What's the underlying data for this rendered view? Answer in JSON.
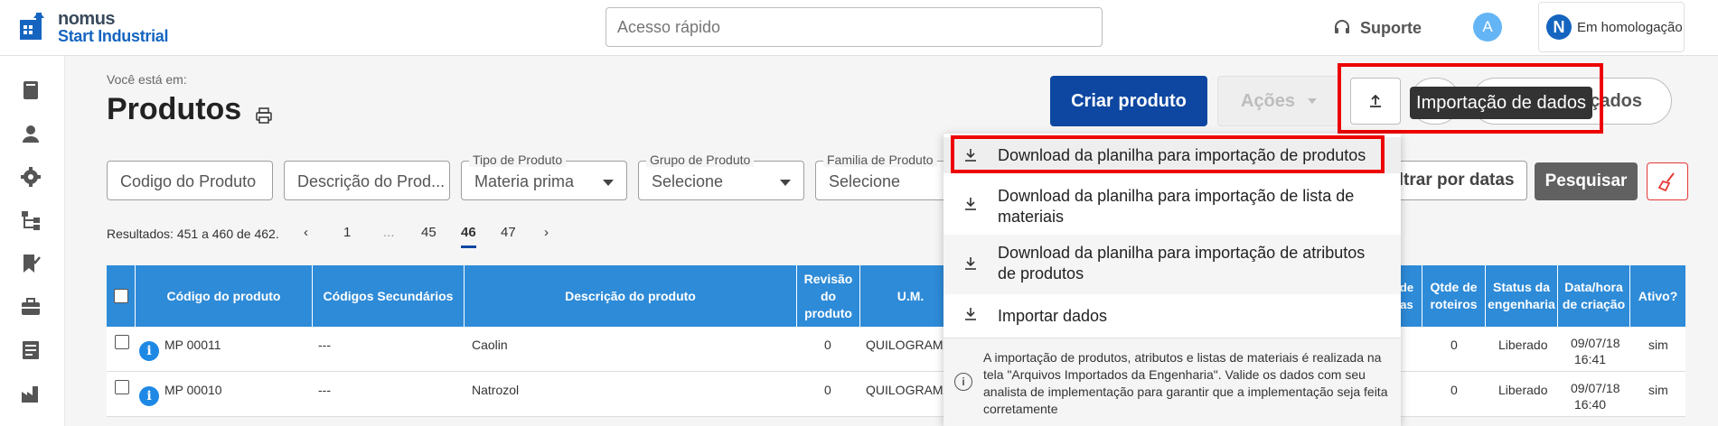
{
  "header": {
    "logo_line1": "nomus",
    "logo_line2": "Start Industrial",
    "quick_access_placeholder": "Acesso rápido",
    "support_label": "Suporte",
    "avatar_initial": "A",
    "env_badge": "N",
    "env_label": "Em homologação"
  },
  "page": {
    "breadcrumb": "Você está em:",
    "title": "Produtos"
  },
  "toolbar": {
    "create_label": "Criar produto",
    "actions_label": "Ações",
    "advanced_label": "vançados",
    "tooltip": "Importação de dados"
  },
  "filters": {
    "code_placeholder": "Codigo do Produto",
    "desc_placeholder": "Descrição do Prod...",
    "type_label": "Tipo de Produto",
    "type_value": "Materia prima",
    "group_label": "Grupo de Produto",
    "group_value": "Selecione",
    "family_label": "Familia de Produto",
    "family_value": "Selecione",
    "dates_label": "iltrar por datas",
    "search_label": "Pesquisar"
  },
  "pagination": {
    "results": "Resultados: 451 a 460 de 462.",
    "prev": "‹",
    "p1": "1",
    "ellipsis": "...",
    "p45": "45",
    "p46": "46",
    "p47": "47",
    "next": "›"
  },
  "table": {
    "headers": {
      "code": "Código do produto",
      "secondary": "Códigos Secundários",
      "desc": "Descrição do produto",
      "revision": "Revisão do produto",
      "um": "U.M.",
      "partial": "de as",
      "routes": "Qtde de roteiros",
      "status": "Status da engenharia",
      "created": "Data/hora de criação",
      "active": "Ativo?"
    },
    "rows": [
      {
        "code": "MP 00011",
        "secondary": "---",
        "desc": "Caolin",
        "revision": "0",
        "um": "QUILOGRAMA",
        "routes": "0",
        "status": "Liberado",
        "date": "09/07/18",
        "time": "16:41",
        "active": "sim"
      },
      {
        "code": "MP 00010",
        "secondary": "---",
        "desc": "Natrozol",
        "revision": "0",
        "um": "QUILOGRAMA",
        "routes": "0",
        "status": "Liberado",
        "date": "09/07/18",
        "time": "16:40",
        "active": "sim"
      }
    ]
  },
  "menu": {
    "item1": "Download da planilha para importação de produtos",
    "item2": "Download da planilha para importação de lista de materiais",
    "item3": "Download da planilha para importação de atributos de produtos",
    "item4": "Importar dados",
    "note": "A importação de produtos, atributos e listas de materiais é realizada na tela \"Arquivos Importados da Engenharia\". Valide os dados com seu analista de implementação para garantir que a implementação seja feita corretamente",
    "note_icon": "i"
  },
  "colors": {
    "primary": "#0d47a1",
    "table_header": "#2e8bd8",
    "highlight": "#e00000"
  }
}
